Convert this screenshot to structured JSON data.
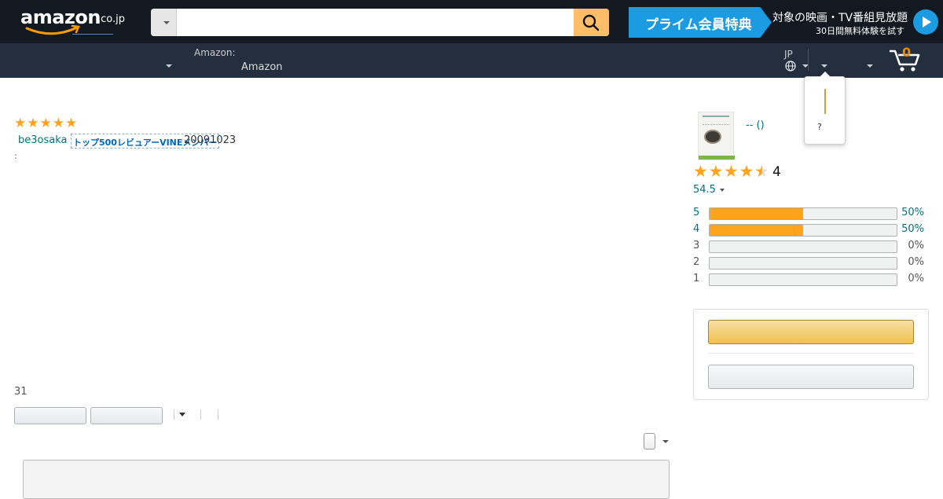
{
  "header": {
    "logo_text": "amazon",
    "logo_domain": ".co.jp",
    "search": {
      "value": "",
      "placeholder": ""
    },
    "prime": {
      "label": "プライム会員特典",
      "tagline": "対象の映画・TV番組見放題",
      "subline": "30日間無料体験を試す"
    },
    "address_small": "Amazon:",
    "address_big": "Amazon",
    "language_code": "JP",
    "cart_count": "0",
    "accent_color": "#febd69",
    "nav_color": "#131921"
  },
  "flyout": {
    "question": "?"
  },
  "review": {
    "rating": 5,
    "star_glyph": "★",
    "reviewer": "be3osaka",
    "vine_badge": "トップ500レビュアーVINEメンバー",
    "date": "20091023",
    "body_prefix": ":",
    "helpful_count": "31"
  },
  "sidebar": {
    "product_title": "-- ()",
    "average_rating": 4.5,
    "average_text": "4",
    "rating_count": "54.5",
    "histogram": [
      {
        "star": "5",
        "percent": 50,
        "percent_text": "50%",
        "linked": true
      },
      {
        "star": "4",
        "percent": 50,
        "percent_text": "50%",
        "linked": true
      },
      {
        "star": "3",
        "percent": 0,
        "percent_text": "0%",
        "linked": false
      },
      {
        "star": "2",
        "percent": 0,
        "percent_text": "0%",
        "linked": false
      },
      {
        "star": "1",
        "percent": 0,
        "percent_text": "0%",
        "linked": false
      }
    ],
    "star_color": "#ffa41c",
    "link_color": "#007185"
  }
}
